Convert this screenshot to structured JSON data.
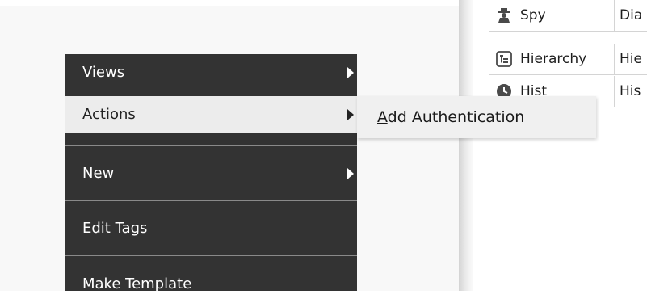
{
  "table": {
    "rows": [
      {
        "name": "Spy",
        "col2": "Dia",
        "icon": "spy-icon"
      },
      {
        "name": "Hierarchy",
        "col2": "Hie",
        "icon": "hierarchy-icon"
      },
      {
        "name": "Hist",
        "col2": "His",
        "icon": "history-icon"
      }
    ]
  },
  "menu": {
    "items": [
      {
        "label": "Views",
        "has_submenu": true
      },
      {
        "label": "Actions",
        "has_submenu": true
      },
      {
        "label": "New",
        "has_submenu": true
      },
      {
        "label": "Edit Tags",
        "has_submenu": false
      },
      {
        "label": "Make Template",
        "has_submenu": false
      }
    ],
    "active_item": "Actions"
  },
  "submenu": {
    "item": {
      "mnemonic": "A",
      "rest": "dd Authentication"
    }
  },
  "colors": {
    "menu_bg": "#333333",
    "menu_highlight": "#ececec",
    "submenu_bg": "#f0f0f0"
  }
}
